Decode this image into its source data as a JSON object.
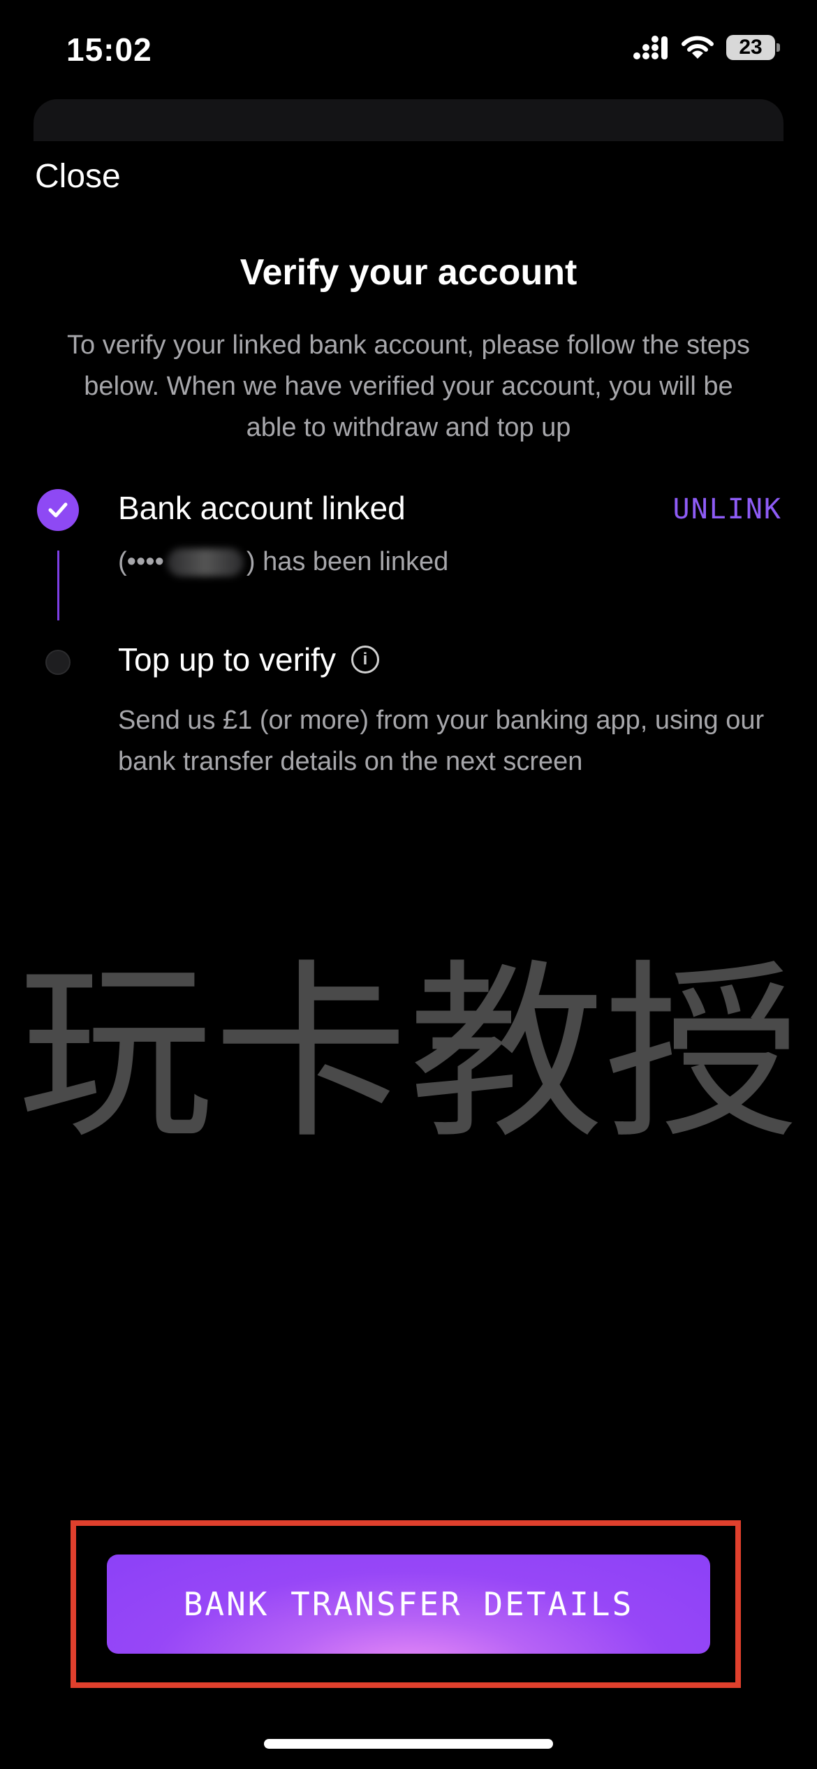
{
  "status_bar": {
    "time": "15:02",
    "battery_level": "23"
  },
  "header": {
    "close_label": "Close"
  },
  "main": {
    "title": "Verify your account",
    "subtitle": "To verify your linked bank account, please follow the steps below. When we have verified your account, you will be able to withdraw and top up",
    "steps": [
      {
        "title": "Bank account linked",
        "status": "complete",
        "action_label": "UNLINK",
        "desc_prefix": "(••••",
        "desc_suffix": ") has been linked"
      },
      {
        "title": "Top up to verify",
        "status": "pending",
        "info_glyph": "i",
        "desc": "Send us £1 (or more) from your banking app, using our bank transfer details on the next screen"
      }
    ]
  },
  "watermark": {
    "text": "玩卡教授"
  },
  "footer": {
    "cta_label": "BANK TRANSFER DETAILS"
  },
  "colors": {
    "accent": "#8e49f4",
    "link": "#8e5cf6",
    "highlight": "#e0402d",
    "background": "#000000"
  }
}
